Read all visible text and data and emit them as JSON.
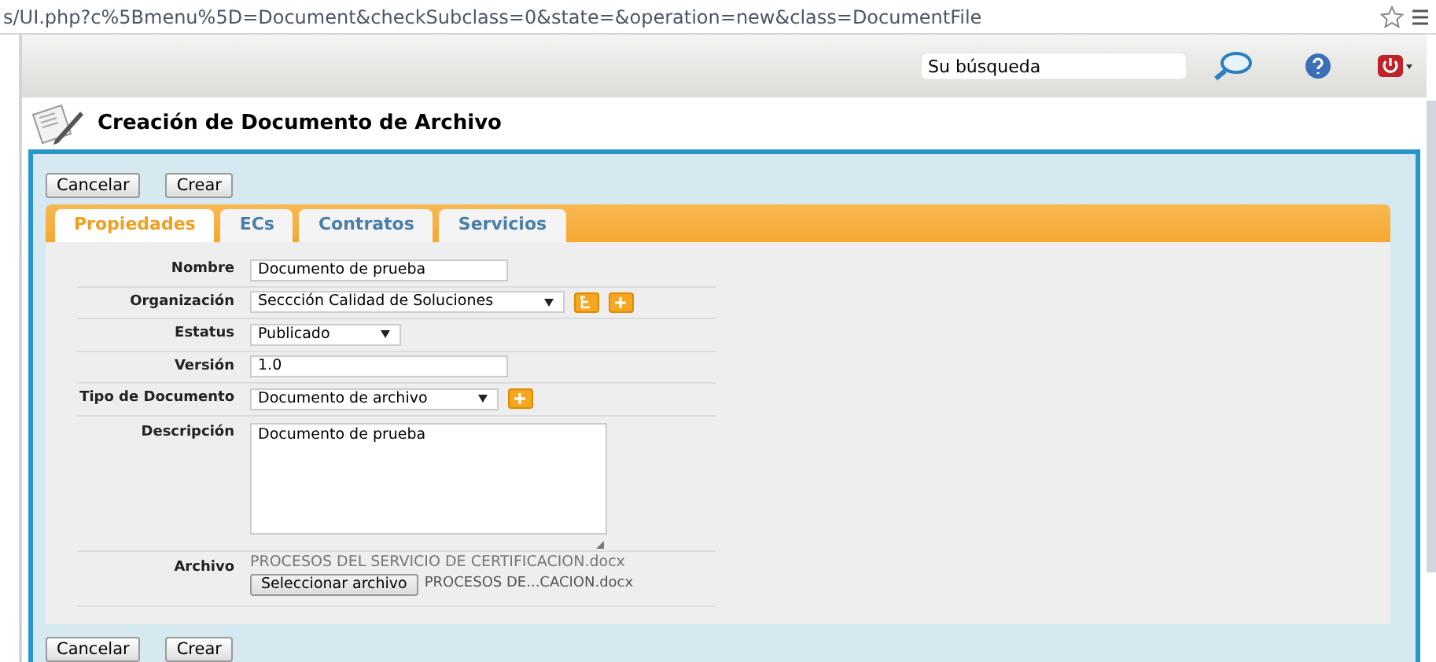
{
  "address_bar": {
    "url": "s/UI.php?c%5Bmenu%5D=Document&checkSubclass=0&state=&operation=new&class=DocumentFile"
  },
  "search": {
    "placeholder": "Su búsqueda"
  },
  "page_title": "Creación de Documento de Archivo",
  "top_buttons": [
    "Cancelar",
    "Crear"
  ],
  "tabs": [
    {
      "label": "Propiedades",
      "selected": true
    },
    {
      "label": "ECs",
      "selected": false
    },
    {
      "label": "Contratos",
      "selected": false
    },
    {
      "label": "Servicios",
      "selected": false
    }
  ],
  "fields": [
    {
      "kind": "text",
      "label": "Nombre",
      "value": "Documento de prueba"
    },
    {
      "kind": "select",
      "label": "Organización",
      "value": "Seccción Calidad de Soluciones",
      "tree_button": true,
      "add_button": true
    },
    {
      "kind": "select",
      "label": "Estatus",
      "value": "Publicado"
    },
    {
      "kind": "text",
      "label": "Versión",
      "value": "1.0"
    },
    {
      "kind": "select",
      "label": "Tipo de Documento",
      "value": "Documento de archivo",
      "add_button": true
    },
    {
      "kind": "textarea",
      "label": "Descripción",
      "value": "Documento de prueba"
    },
    {
      "kind": "file",
      "label": "Archivo",
      "current": "PROCESOS DEL SERVICIO DE CERTIFICACION.docx",
      "button": "Seleccionar archivo",
      "chosen": "PROCESOS DE...CACION.docx"
    }
  ],
  "bottom_buttons": [
    "Cancelar",
    "Crear"
  ]
}
